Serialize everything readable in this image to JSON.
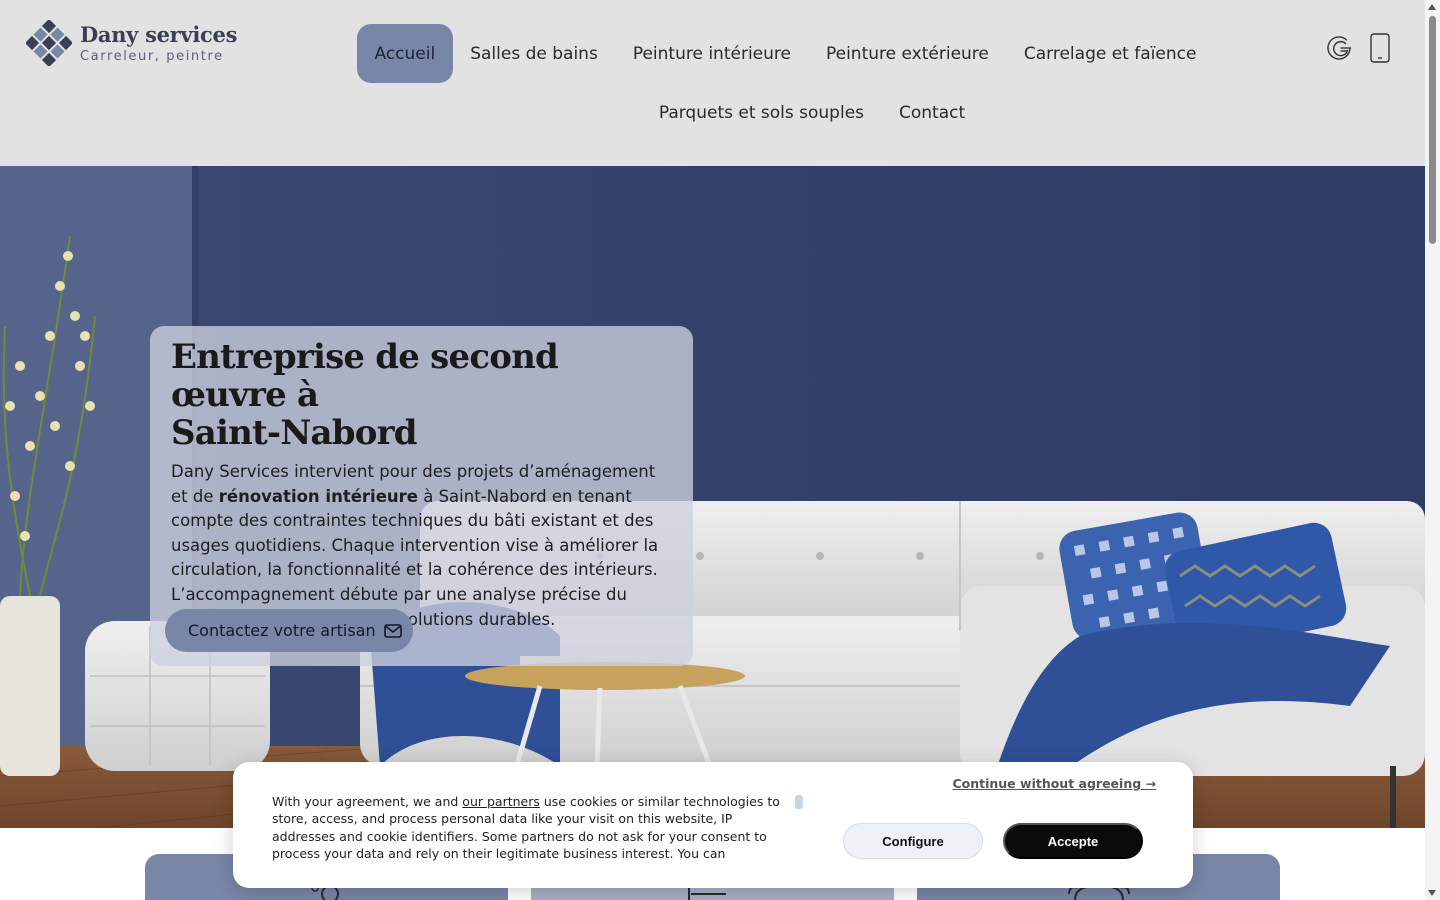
{
  "brand": {
    "name": "Dany services",
    "tagline": "Carreleur, peintre"
  },
  "nav": {
    "items": [
      {
        "label": "Accueil",
        "active": true
      },
      {
        "label": "Salles de bains"
      },
      {
        "label": "Peinture intérieure"
      },
      {
        "label": "Peinture extérieure"
      },
      {
        "label": "Carrelage et faïence"
      },
      {
        "label": "Parquets et sols souples"
      },
      {
        "label": "Contact"
      }
    ]
  },
  "header_icons": [
    "google-icon",
    "phone-icon"
  ],
  "hero": {
    "title_line1": "Entreprise de second œuvre à",
    "title_line2": "Saint-Nabord",
    "text_part1": "Dany Services intervient pour des projets d’aménagement et de ",
    "text_bold": "rénovation intérieure",
    "text_part2": " à Saint-Nabord en tenant compte des contraintes techniques du bâti existant et des usages quotidiens. Chaque intervention vise à améliorer la circulation, la fonctionnalité et la cohérence des intérieurs. L’accompagnement débute par une analyse précise du projet afin de proposer des solutions durables.",
    "cta_label": "Contactez votre artisan"
  },
  "cookie": {
    "text_part1": "With your agreement, we and ",
    "link": "our partners",
    "text_part2": " use cookies or similar technologies to store, access, and process personal data like your visit on this website, IP addresses and cookie identifiers. Some partners do not ask for your consent to process your data and rely on their legitimate business interest. You can",
    "continue_label": "Continue without agreeing →",
    "configure_label": "Configure",
    "accept_label": "Accepte"
  },
  "colors": {
    "header_bg": "#e2e2e2",
    "accent": "#7a86a8",
    "wall": "#3f4e78",
    "accept_bg": "#0b0b0b"
  }
}
